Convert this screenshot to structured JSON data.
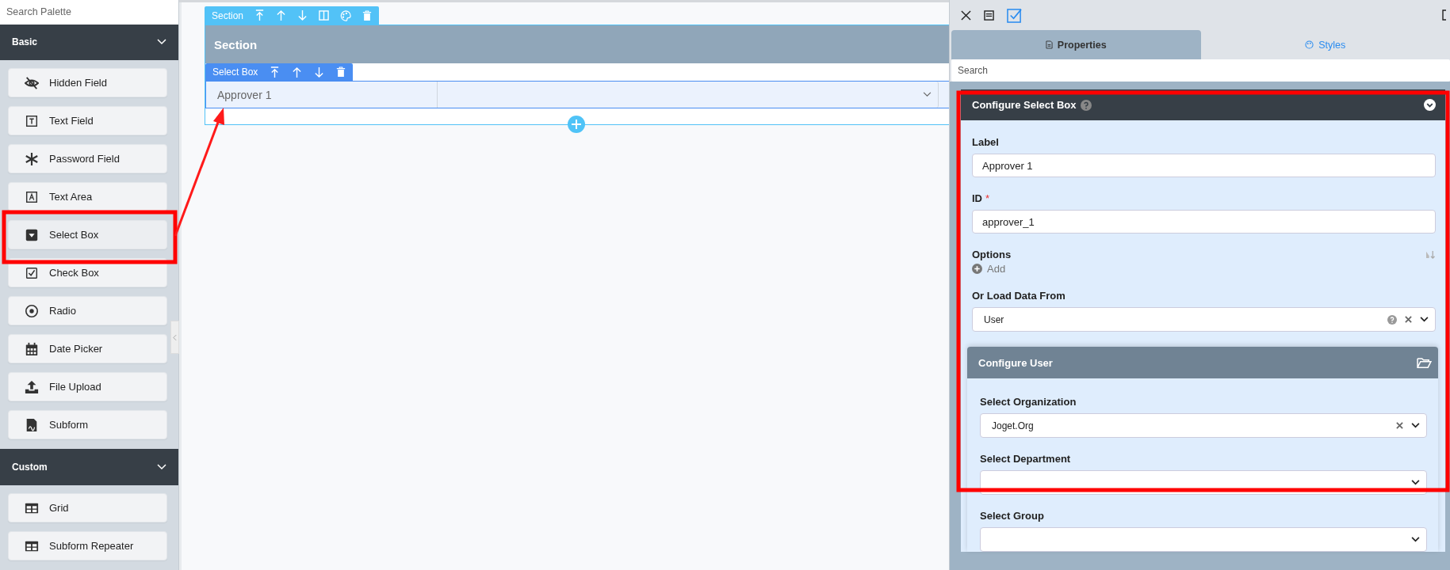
{
  "palette": {
    "search": {
      "placeholder": "Search Palette"
    },
    "groups": [
      {
        "title": "Basic",
        "expanded": true,
        "items": [
          {
            "label": "Hidden Field",
            "kind": "hidden",
            "selected": false
          },
          {
            "label": "Text Field",
            "kind": "text",
            "selected": false
          },
          {
            "label": "Password Field",
            "kind": "password",
            "selected": false
          },
          {
            "label": "Text Area",
            "kind": "textarea",
            "selected": false
          },
          {
            "label": "Select Box",
            "kind": "select",
            "selected": true
          },
          {
            "label": "Check Box",
            "kind": "checkbox",
            "selected": false
          },
          {
            "label": "Radio",
            "kind": "radio",
            "selected": false
          },
          {
            "label": "Date Picker",
            "kind": "date",
            "selected": false
          },
          {
            "label": "File Upload",
            "kind": "upload",
            "selected": false
          },
          {
            "label": "Subform",
            "kind": "subform",
            "selected": false
          }
        ]
      },
      {
        "title": "Custom",
        "expanded": true,
        "items": [
          {
            "label": "Grid",
            "kind": "grid",
            "selected": false
          },
          {
            "label": "Subform Repeater",
            "kind": "grid",
            "selected": false
          }
        ]
      }
    ]
  },
  "canvas": {
    "section": {
      "toolbar_label": "Section",
      "title": "Section",
      "field": {
        "toolbar_label": "Select Box",
        "label": "Approver 1"
      }
    }
  },
  "properties_panel": {
    "tabs": [
      {
        "label": "Properties",
        "selected": true
      },
      {
        "label": "Styles",
        "selected": false
      }
    ],
    "search": {
      "placeholder": "Search"
    },
    "config": {
      "title": "Configure Select Box",
      "fields": [
        {
          "kind": "text",
          "label": "Label",
          "value": "Approver 1"
        },
        {
          "kind": "text",
          "label": "ID",
          "value": "approver_1",
          "required_mark": "*"
        },
        {
          "kind": "options",
          "label": "Options",
          "add_label": "Add"
        },
        {
          "kind": "select",
          "label": "Or Load Data From",
          "value": "User",
          "help": true,
          "clearable": true
        }
      ],
      "subpanel": {
        "title": "Configure User",
        "fields": [
          {
            "kind": "select",
            "label": "Select Organization",
            "value": "Joget.Org",
            "clearable": true
          },
          {
            "kind": "select",
            "label": "Select Department",
            "clearable": false
          },
          {
            "kind": "select",
            "label": "Select Group",
            "clearable": false
          }
        ]
      }
    }
  }
}
